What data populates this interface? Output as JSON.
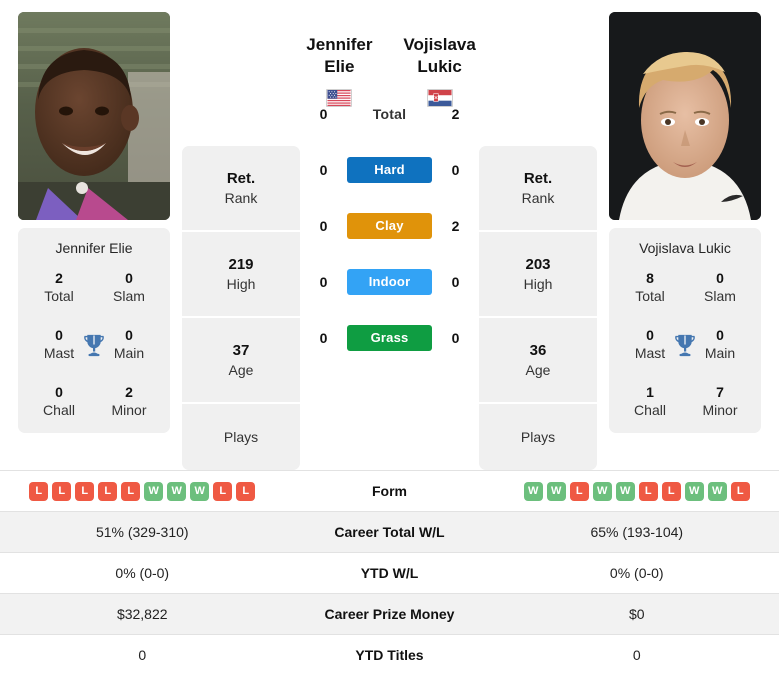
{
  "players": {
    "left": {
      "name": "Jennifer Elie",
      "flag": "us-flag-icon",
      "card_name": "Jennifer Elie",
      "titles": [
        {
          "num": "2",
          "label": "Total"
        },
        {
          "num": "0",
          "label": "Slam"
        },
        {
          "num": "0",
          "label": "Mast"
        },
        {
          "num": "0",
          "label": "Main"
        },
        {
          "num": "0",
          "label": "Chall"
        },
        {
          "num": "2",
          "label": "Minor"
        }
      ],
      "rank": [
        {
          "num": "Ret.",
          "label": "Rank"
        },
        {
          "num": "219",
          "label": "High"
        },
        {
          "num": "37",
          "label": "Age"
        },
        {
          "num": "",
          "label": "Plays"
        }
      ]
    },
    "right": {
      "name": "Vojislava Lukic",
      "flag": "serbia-flag-icon",
      "card_name": "Vojislava Lukic",
      "titles": [
        {
          "num": "8",
          "label": "Total"
        },
        {
          "num": "0",
          "label": "Slam"
        },
        {
          "num": "0",
          "label": "Mast"
        },
        {
          "num": "0",
          "label": "Main"
        },
        {
          "num": "1",
          "label": "Chall"
        },
        {
          "num": "7",
          "label": "Minor"
        }
      ],
      "rank": [
        {
          "num": "Ret.",
          "label": "Rank"
        },
        {
          "num": "203",
          "label": "High"
        },
        {
          "num": "36",
          "label": "Age"
        },
        {
          "num": "",
          "label": "Plays"
        }
      ]
    }
  },
  "trophy_icon": "trophy-icon",
  "surfaces": [
    {
      "label": "Total",
      "left": "0",
      "right": "2",
      "color": "transparent",
      "plain": true
    },
    {
      "label": "Hard",
      "left": "0",
      "right": "0",
      "color": "#0f72bf",
      "plain": false
    },
    {
      "label": "Clay",
      "left": "0",
      "right": "2",
      "color": "#e0930a",
      "plain": false
    },
    {
      "label": "Indoor",
      "left": "0",
      "right": "0",
      "color": "#33a3f5",
      "plain": false
    },
    {
      "label": "Grass",
      "left": "0",
      "right": "0",
      "color": "#0f9d42",
      "plain": false
    }
  ],
  "colors": {
    "win": "#6cbf7d",
    "loss": "#ef5943",
    "card_bg": "#f0f0f0",
    "row_shade": "#f2f2f2",
    "trophy": "#4577b0"
  },
  "table": [
    {
      "label": "Form",
      "type": "form",
      "shade": false,
      "left_form": [
        "L",
        "L",
        "L",
        "L",
        "L",
        "W",
        "W",
        "W",
        "L",
        "L"
      ],
      "right_form": [
        "W",
        "W",
        "L",
        "W",
        "W",
        "L",
        "L",
        "W",
        "W",
        "L"
      ]
    },
    {
      "label": "Career Total W/L",
      "type": "text",
      "shade": true,
      "left": "51% (329-310)",
      "right": "65% (193-104)"
    },
    {
      "label": "YTD W/L",
      "type": "text",
      "shade": false,
      "left": "0% (0-0)",
      "right": "0% (0-0)"
    },
    {
      "label": "Career Prize Money",
      "type": "text",
      "shade": true,
      "left": "$32,822",
      "right": "$0"
    },
    {
      "label": "YTD Titles",
      "type": "text",
      "shade": false,
      "left": "0",
      "right": "0"
    }
  ]
}
